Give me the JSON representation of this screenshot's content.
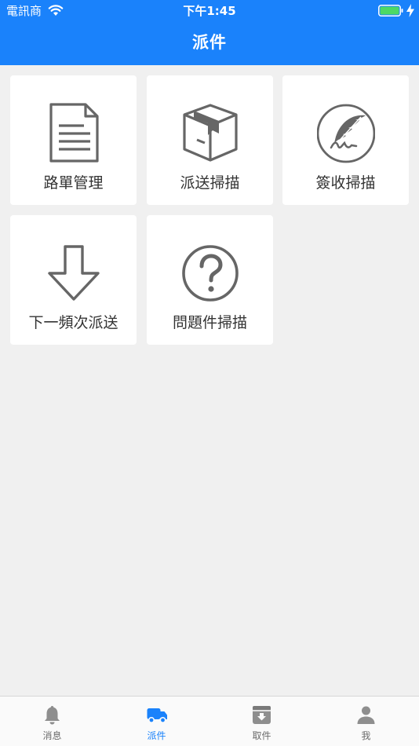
{
  "status_bar": {
    "carrier": "電訊商",
    "time": "下午1:45"
  },
  "header": {
    "title": "派件"
  },
  "menu": {
    "items": [
      {
        "label": "路單管理",
        "icon": "document-icon"
      },
      {
        "label": "派送掃描",
        "icon": "package-icon"
      },
      {
        "label": "簽收掃描",
        "icon": "quill-signature-icon"
      },
      {
        "label": "下一頻次派送",
        "icon": "arrow-down-icon"
      },
      {
        "label": "問題件掃描",
        "icon": "question-circle-icon"
      }
    ]
  },
  "tabbar": {
    "tabs": [
      {
        "label": "消息",
        "icon": "bell-icon"
      },
      {
        "label": "派件",
        "icon": "truck-icon",
        "active": true
      },
      {
        "label": "取件",
        "icon": "inbox-box-icon"
      },
      {
        "label": "我",
        "icon": "person-icon"
      }
    ]
  },
  "colors": {
    "primary": "#1a82fb",
    "background": "#f0f0f0",
    "icon_gray": "#666666",
    "tab_inactive": "#8e8e8e",
    "battery_green": "#4cd964"
  }
}
